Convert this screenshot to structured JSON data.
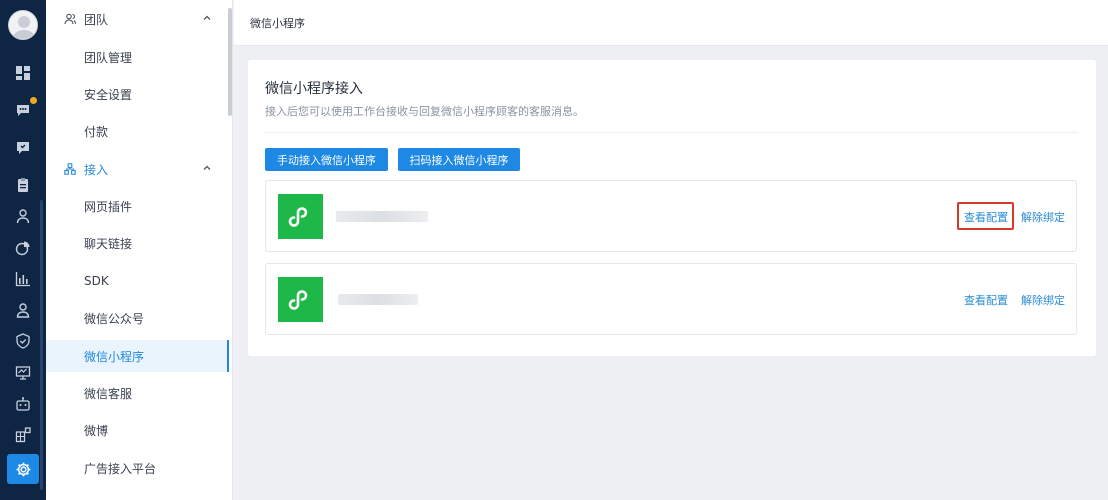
{
  "rail": {
    "icons": [
      "avatar",
      "dashboard-icon",
      "chat-icon",
      "message-icon",
      "clipboard-icon",
      "user-icon",
      "chart-pie-icon",
      "bar-chart-icon",
      "contact-icon",
      "shield-icon",
      "monitor-icon",
      "robot-icon",
      "apps-icon",
      "gear-icon"
    ],
    "colors": {
      "background": "#0f2544",
      "active": "#1e88e5",
      "badge": "#f5a623"
    }
  },
  "menu": {
    "groups": [
      {
        "label": "团队",
        "items": [
          "团队管理",
          "安全设置",
          "付款"
        ]
      },
      {
        "label": "接入",
        "items": [
          "网页插件",
          "聊天链接",
          "SDK",
          "微信公众号",
          "微信小程序",
          "微信客服",
          "微博",
          "广告接入平台"
        ]
      }
    ],
    "active_item": "微信小程序"
  },
  "header": {
    "breadcrumb": "微信小程序"
  },
  "main": {
    "title": "微信小程序接入",
    "subtitle": "接入后您可以使用工作台接收与回复微信小程序顾客的客服消息。",
    "buttons": {
      "manual": "手动接入微信小程序",
      "scan": "扫码接入微信小程序"
    },
    "mini_programs": [
      {
        "view_label": "查看配置",
        "unbind_label": "解除绑定",
        "highlighted": true
      },
      {
        "view_label": "查看配置",
        "unbind_label": "解除绑定",
        "highlighted": false
      }
    ],
    "colors": {
      "accent": "#1e88e5",
      "logo": "#1eb848",
      "highlight": "#d23b2a"
    }
  }
}
